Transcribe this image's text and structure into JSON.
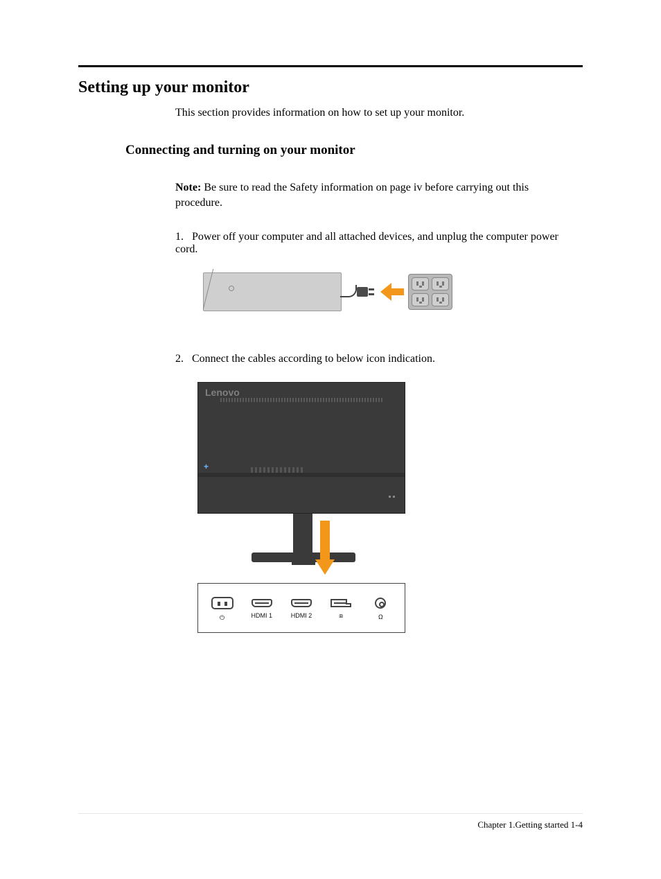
{
  "heading": "Setting up your monitor",
  "intro": "This section provides information on how to set up your monitor.",
  "subheading": "Connecting and turning on your monitor",
  "note_label": "Note:",
  "note_text": " Be sure to read the Safety information on page iv before carrying out this procedure.",
  "steps": {
    "s1_num": "1.",
    "s1_text": "Power off your computer and all attached devices, and unplug the computer power cord.",
    "s2_num": "2.",
    "s2_text": "Connect the cables according to below icon indication."
  },
  "monitor_brand": "Lenovo",
  "ports": {
    "ac_sym": "⏻",
    "hdmi1": "HDMI 1",
    "hdmi2": "HDMI 2",
    "dp_sym": "⧈",
    "audio_sym": "Ω"
  },
  "footer": "Chapter 1.Getting started  1-4"
}
